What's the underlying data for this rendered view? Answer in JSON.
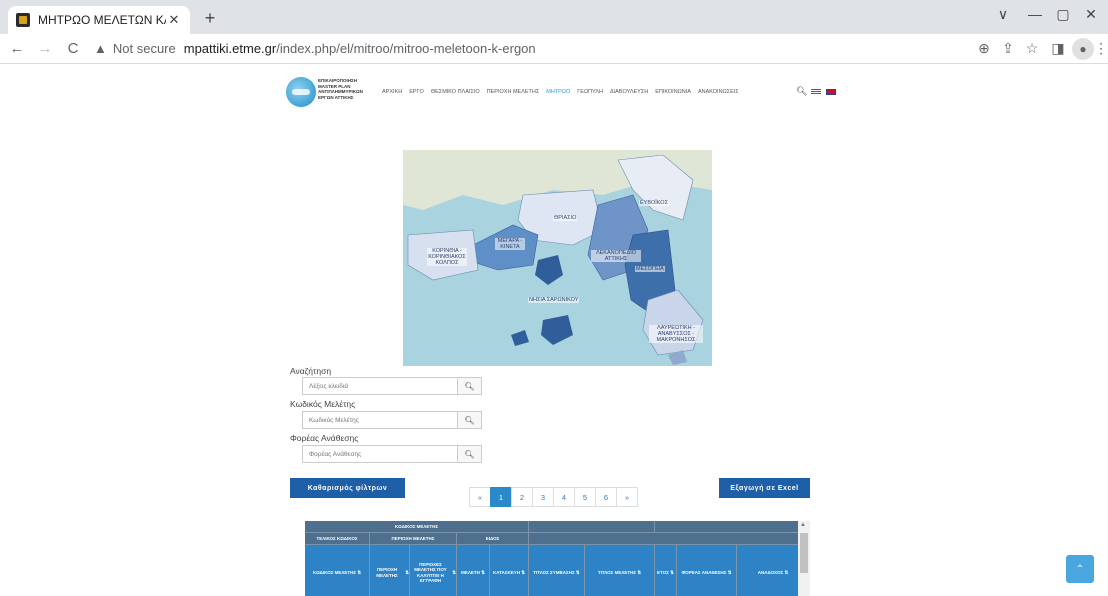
{
  "browser": {
    "tab_title": "ΜΗΤΡΩΟ ΜΕΛΕΤΩΝ ΚΑΙ ΕΡΓΩΝ",
    "tab_close": "✕",
    "new_tab": "+",
    "security_label": "Not secure",
    "url_host": "mpattiki.etme.gr",
    "url_path": "/index.php/el/mitroo/mitroo-meletoon-k-ergon",
    "back": "←",
    "forward": "→",
    "reload": "C",
    "minimize": "—",
    "restore": "▢",
    "close": "✕",
    "chevron": "∨"
  },
  "site": {
    "logo_lines": [
      "ΕΠΙΚΑΙΡΟΠΟΙΗΣΗ",
      "MASTER PLAN",
      "ΑΝΤΙΠΛΗΜΜΥΡΙΚΩΝ",
      "ΕΡΓΩΝ ΑΤΤΙΚΗΣ"
    ],
    "nav": [
      "ΑΡΧΙΚΗ",
      "ΕΡΓΟ",
      "ΘΕΣΜΙΚΟ ΠΛΑΙΣΙΟ",
      "ΠΕΡΙΟΧΗ ΜΕΛΕΤΗΣ",
      "ΜΗΤΡΩΟ",
      "ΓΕΩΠΥΛΗ",
      "ΔΙΑΒΟΥΛΕΥΣΗ",
      "ΕΠΙΚΟΙΝΩΝΙΑ",
      "ΑΝΑΚΟΙΝΩΣΕΙΣ"
    ],
    "active_nav": "ΜΗΤΡΩΟ"
  },
  "map": {
    "labels": {
      "evoikos": "ΕΥΒΟΪΚΟΣ",
      "thriasio": "ΘΡΙΑΣΙΟ",
      "megara": "ΜΕΓΑΡΑ - ΚΙΝΕΤΑ",
      "korinthia": "ΚΟΡΙΝΘΙΑ - ΚΟΡΙΝΘΙΑΚΟΣ ΚΟΛΠΟΣ",
      "lekanopedio": "ΛΕΚΑΝΟΠΕΔΙΟ ΑΤΤΙΚΗΣ",
      "mesogeia": "ΜΕΣΟΓΕΙΑ",
      "nisia": "ΝΗΣΙΑ ΣΑΡΩΝΙΚΟΥ",
      "lavreotiki": "ΛΑΥΡΕΩΤΙΚΗ - ΑΝΑΒΥΣΣΟΣ - ΜΑΚΡΟΝΗΣΟΣ"
    }
  },
  "filters": {
    "search_label": "Αναζήτηση",
    "search_placeholder": "Λέξεις κλειδιά",
    "code_label": "Κωδικός Μελέτης",
    "code_placeholder": "Κωδικός Μελέτης",
    "agency_label": "Φορέας Ανάθεσης",
    "agency_placeholder": "Φορέας Ανάθεσης"
  },
  "actions": {
    "clear_filters": "Καθαρισμός φίλτρων",
    "export_excel": "Εξαγωγή σε Excel"
  },
  "pagination": {
    "prev": "«",
    "pages": [
      "1",
      "2",
      "3",
      "4",
      "5",
      "6"
    ],
    "next": "»",
    "current": "1"
  },
  "table": {
    "group_code": "ΚΩΔΙΚΟΣ ΜΕΛΕΤΗΣ",
    "final_code": "ΤΕΛΙΚΟΣ ΚΩΔΙΚΟΣ",
    "study_area": "ΠΕΡΙΟΧΗ ΜΕΛΕΤΗΣ",
    "type": "ΕΙΔΟΣ",
    "col_code": "ΚΩΔΙΚΟΣ ΜΕΛΕΤΗΣ",
    "col_area": "ΠΕΡΙΟΧΗ ΜΕΛΕΤΗΣ",
    "col_cover": "ΠΕΡΙΟΧΕΣ ΜΕΛΕΤΗΣ ΠΟΥ ΚΑΛΥΠΤΕΙ Η ΕΓΓΡΑΦΗ",
    "col_study": "ΜΕΛΕΤΗ",
    "col_construction": "ΚΑΤΑΣΚΕΥΗ",
    "col_contract": "ΤΙΤΛΟΣ ΣΥΜΒΑΣΗΣ",
    "col_title": "ΤΙΤΛΟΣ ΜΕΛΕΤΗΣ",
    "col_year": "ΕΤΟΣ",
    "col_agency": "ΦΟΡΕΑΣ ΑΝΑΘΕΣΗΣ",
    "col_contractor": "ΑΝΑΔΟΧΟΣ",
    "sort_glyph": "⇅"
  },
  "back_to_top": "⌃"
}
